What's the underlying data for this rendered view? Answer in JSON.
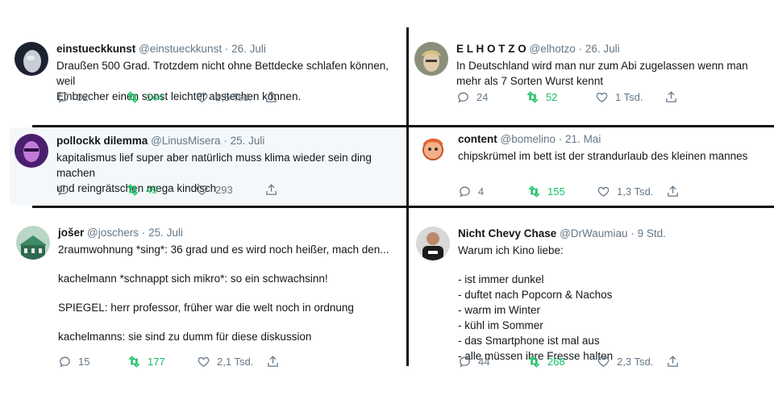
{
  "tweets": [
    {
      "name": "einstueckkunst",
      "handle": "@einstueckkunst",
      "date": "26. Juli",
      "lines": [
        "Draußen 500 Grad. Trotzdem nicht ohne Bettdecke schlafen können, weil",
        "Einbrecher einen sonst leichter abstechen können."
      ],
      "replies": "32",
      "retweets": "144",
      "likes": "1,5 Tsd.",
      "avatar": "avatar-pale-face"
    },
    {
      "name": "E L H O T Z O",
      "handle": "@elhotzo",
      "date": "26. Juli",
      "lines": [
        "In Deutschland wird man nur zum Abi zugelassen wenn man",
        "mehr als 7 Sorten Wurst kennt"
      ],
      "replies": "24",
      "retweets": "52",
      "likes": "1 Tsd.",
      "avatar": "avatar-blond-man"
    },
    {
      "name": "pollockk dilemma",
      "handle": "@LinusMisera",
      "date": "25. Juli",
      "lines": [
        "kapitalismus lief super aber natürlich muss klima wieder sein ding machen",
        "und reingrätschen mega kindisch"
      ],
      "replies": "",
      "retweets": "49",
      "likes": "293",
      "avatar": "avatar-purple-portrait"
    },
    {
      "name": "content",
      "handle": "@bomelino",
      "date": "21. Mai",
      "lines": [
        "chipskrümel im bett ist der strandurlaub des kleinen mannes"
      ],
      "replies": "4",
      "retweets": "155",
      "likes": "1,3 Tsd.",
      "avatar": "avatar-cartoon-character"
    },
    {
      "name": "jošer",
      "handle": "@joschers",
      "date": "25. Juli",
      "lines": [
        "2raumwohnung *sing*:  36 grad und es wird noch heißer, mach den...",
        "",
        "kachelmann *schnappt sich mikro*: so ein schwachsinn!",
        "",
        "SPIEGEL: herr professor, früher war die welt noch in ordnung",
        "",
        "kachelmanns: sie sind zu dumm für diese diskussion"
      ],
      "replies": "15",
      "retweets": "177",
      "likes": "2,1 Tsd.",
      "avatar": "avatar-green-building"
    },
    {
      "name": "Nicht Chevy Chase",
      "handle": "@DrWaumiau",
      "date": "9 Std.",
      "lines": [
        "Warum ich Kino liebe:",
        "",
        "- ist immer dunkel",
        "- duftet nach Popcorn & Nachos",
        "- warm im Winter",
        "- kühl im Sommer",
        "- das Smartphone ist mal aus",
        "- alle müssen ihre Fresse halten"
      ],
      "replies": "44",
      "retweets": "268",
      "likes": "2,3 Tsd.",
      "avatar": "avatar-man-in-tshirt"
    }
  ],
  "colors": {
    "retweet": "#17bf63",
    "meta": "#657786",
    "text": "#14171a"
  },
  "icons": {
    "reply": "reply-icon",
    "retweet": "retweet-icon",
    "like": "like-icon",
    "share": "share-icon"
  }
}
